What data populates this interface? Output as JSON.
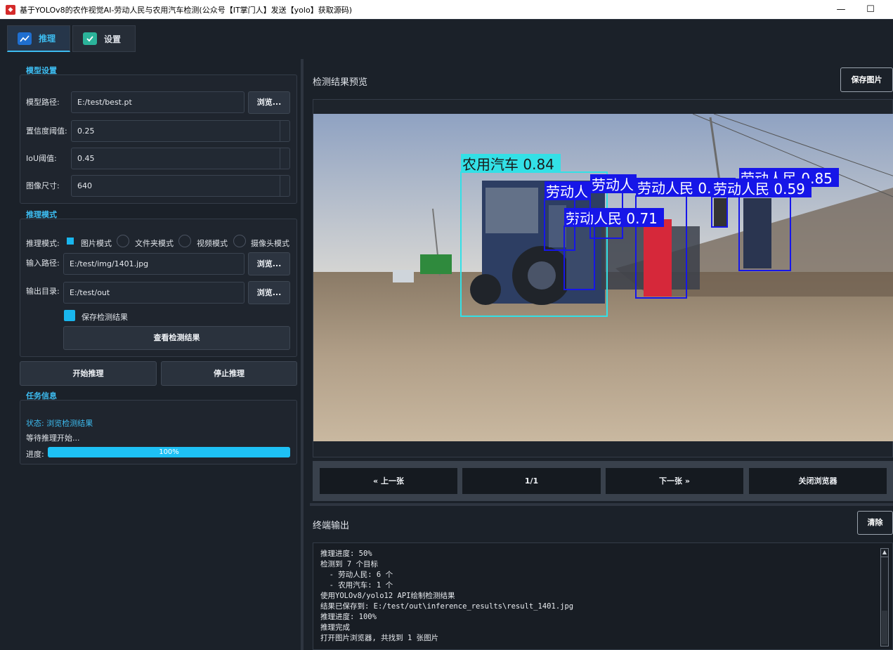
{
  "window": {
    "title": "基于YOLOv8的农作视觉AI-劳动人民与农用汽车检测(公众号【IT掌门人】发送【yolo】获取源码)",
    "minimize": "—",
    "maximize": "☐"
  },
  "tabs": [
    {
      "label": "推理",
      "icon": "chart-icon",
      "active": true
    },
    {
      "label": "设置",
      "icon": "check-icon",
      "active": false
    }
  ],
  "model_settings": {
    "title": "模型设置",
    "model_path_label": "模型路径:",
    "model_path": "E:/test/best.pt",
    "browse": "浏览...",
    "conf_label": "置信度阈值:",
    "conf": "0.25",
    "iou_label": "IoU阈值:",
    "iou": "0.45",
    "imgsz_label": "图像尺寸:",
    "imgsz": "640"
  },
  "infer_mode": {
    "title": "推理模式",
    "mode_label": "推理模式:",
    "modes": [
      "图片模式",
      "文件夹模式",
      "视频模式",
      "摄像头模式"
    ],
    "selected": "图片模式",
    "input_label": "输入路径:",
    "input_path": "E:/test/img/1401.jpg",
    "output_label": "输出目录:",
    "output_path": "E:/test/out",
    "browse": "浏览...",
    "save_label": "保存检测结果",
    "save_checked": true,
    "view_results": "查看检测结果"
  },
  "actions": {
    "start": "开始推理",
    "stop": "停止推理"
  },
  "task_info": {
    "title": "任务信息",
    "status": "状态: 浏览检测结果",
    "message": "等待推理开始...",
    "progress_label": "进度:",
    "progress_value": 100,
    "progress_text": "100%"
  },
  "preview": {
    "title": "检测结果预览",
    "save_image": "保存图片",
    "detections": [
      {
        "label": "农用汽车 0.84",
        "class": "tractor"
      },
      {
        "label": "劳动人民 0.85",
        "class": "person"
      },
      {
        "label": "劳动人民 0.85",
        "class": "person"
      },
      {
        "label": "劳动人民 0.71",
        "class": "person"
      },
      {
        "label": "劳动人民 0.59",
        "class": "person"
      },
      {
        "label": "劳动人",
        "class": "person"
      },
      {
        "label": "劳动人",
        "class": "person"
      }
    ],
    "nav": {
      "prev": "« 上一张",
      "counter": "1/1",
      "next": "下一张 »",
      "close": "关闭浏览器"
    }
  },
  "terminal": {
    "title": "终端输出",
    "clear": "清除",
    "lines": [
      "推理进度: 50%",
      "检测到 7 个目标",
      "  - 劳动人民: 6 个",
      "  - 农用汽车: 1 个",
      "使用YOLOv8/yolo12 API绘制检测结果",
      "结果已保存到: E:/test/out\\inference_results\\result_1401.jpg",
      "推理进度: 100%",
      "推理完成",
      "打开图片浏览器, 共找到 1 张图片"
    ]
  },
  "colors": {
    "accent": "#3dbcf0",
    "tractor_box": "#33e0e6",
    "person_box": "#1616e8"
  }
}
